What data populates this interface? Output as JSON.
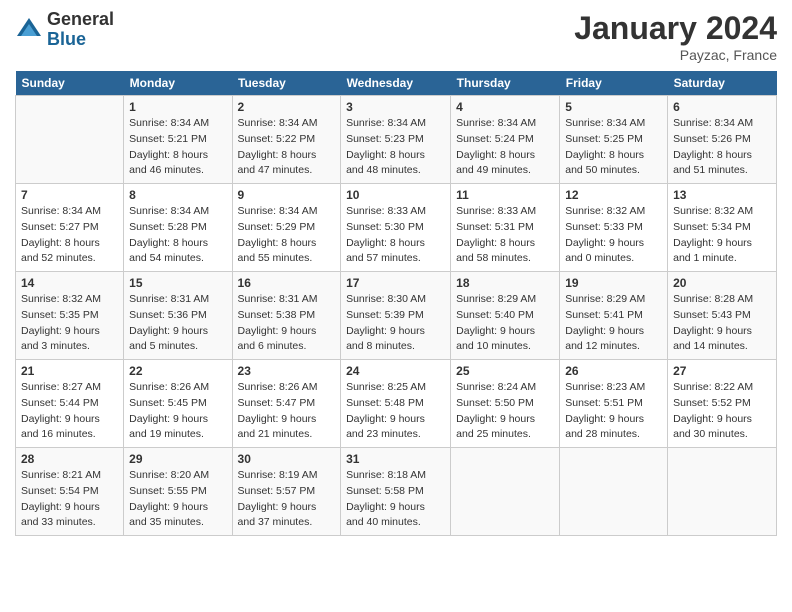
{
  "logo": {
    "general": "General",
    "blue": "Blue"
  },
  "header": {
    "month": "January 2024",
    "location": "Payzac, France"
  },
  "weekdays": [
    "Sunday",
    "Monday",
    "Tuesday",
    "Wednesday",
    "Thursday",
    "Friday",
    "Saturday"
  ],
  "weeks": [
    [
      {
        "day": "",
        "sunrise": "",
        "sunset": "",
        "daylight": ""
      },
      {
        "day": "1",
        "sunrise": "Sunrise: 8:34 AM",
        "sunset": "Sunset: 5:21 PM",
        "daylight": "Daylight: 8 hours and 46 minutes."
      },
      {
        "day": "2",
        "sunrise": "Sunrise: 8:34 AM",
        "sunset": "Sunset: 5:22 PM",
        "daylight": "Daylight: 8 hours and 47 minutes."
      },
      {
        "day": "3",
        "sunrise": "Sunrise: 8:34 AM",
        "sunset": "Sunset: 5:23 PM",
        "daylight": "Daylight: 8 hours and 48 minutes."
      },
      {
        "day": "4",
        "sunrise": "Sunrise: 8:34 AM",
        "sunset": "Sunset: 5:24 PM",
        "daylight": "Daylight: 8 hours and 49 minutes."
      },
      {
        "day": "5",
        "sunrise": "Sunrise: 8:34 AM",
        "sunset": "Sunset: 5:25 PM",
        "daylight": "Daylight: 8 hours and 50 minutes."
      },
      {
        "day": "6",
        "sunrise": "Sunrise: 8:34 AM",
        "sunset": "Sunset: 5:26 PM",
        "daylight": "Daylight: 8 hours and 51 minutes."
      }
    ],
    [
      {
        "day": "7",
        "sunrise": "Sunrise: 8:34 AM",
        "sunset": "Sunset: 5:27 PM",
        "daylight": "Daylight: 8 hours and 52 minutes."
      },
      {
        "day": "8",
        "sunrise": "Sunrise: 8:34 AM",
        "sunset": "Sunset: 5:28 PM",
        "daylight": "Daylight: 8 hours and 54 minutes."
      },
      {
        "day": "9",
        "sunrise": "Sunrise: 8:34 AM",
        "sunset": "Sunset: 5:29 PM",
        "daylight": "Daylight: 8 hours and 55 minutes."
      },
      {
        "day": "10",
        "sunrise": "Sunrise: 8:33 AM",
        "sunset": "Sunset: 5:30 PM",
        "daylight": "Daylight: 8 hours and 57 minutes."
      },
      {
        "day": "11",
        "sunrise": "Sunrise: 8:33 AM",
        "sunset": "Sunset: 5:31 PM",
        "daylight": "Daylight: 8 hours and 58 minutes."
      },
      {
        "day": "12",
        "sunrise": "Sunrise: 8:32 AM",
        "sunset": "Sunset: 5:33 PM",
        "daylight": "Daylight: 9 hours and 0 minutes."
      },
      {
        "day": "13",
        "sunrise": "Sunrise: 8:32 AM",
        "sunset": "Sunset: 5:34 PM",
        "daylight": "Daylight: 9 hours and 1 minute."
      }
    ],
    [
      {
        "day": "14",
        "sunrise": "Sunrise: 8:32 AM",
        "sunset": "Sunset: 5:35 PM",
        "daylight": "Daylight: 9 hours and 3 minutes."
      },
      {
        "day": "15",
        "sunrise": "Sunrise: 8:31 AM",
        "sunset": "Sunset: 5:36 PM",
        "daylight": "Daylight: 9 hours and 5 minutes."
      },
      {
        "day": "16",
        "sunrise": "Sunrise: 8:31 AM",
        "sunset": "Sunset: 5:38 PM",
        "daylight": "Daylight: 9 hours and 6 minutes."
      },
      {
        "day": "17",
        "sunrise": "Sunrise: 8:30 AM",
        "sunset": "Sunset: 5:39 PM",
        "daylight": "Daylight: 9 hours and 8 minutes."
      },
      {
        "day": "18",
        "sunrise": "Sunrise: 8:29 AM",
        "sunset": "Sunset: 5:40 PM",
        "daylight": "Daylight: 9 hours and 10 minutes."
      },
      {
        "day": "19",
        "sunrise": "Sunrise: 8:29 AM",
        "sunset": "Sunset: 5:41 PM",
        "daylight": "Daylight: 9 hours and 12 minutes."
      },
      {
        "day": "20",
        "sunrise": "Sunrise: 8:28 AM",
        "sunset": "Sunset: 5:43 PM",
        "daylight": "Daylight: 9 hours and 14 minutes."
      }
    ],
    [
      {
        "day": "21",
        "sunrise": "Sunrise: 8:27 AM",
        "sunset": "Sunset: 5:44 PM",
        "daylight": "Daylight: 9 hours and 16 minutes."
      },
      {
        "day": "22",
        "sunrise": "Sunrise: 8:26 AM",
        "sunset": "Sunset: 5:45 PM",
        "daylight": "Daylight: 9 hours and 19 minutes."
      },
      {
        "day": "23",
        "sunrise": "Sunrise: 8:26 AM",
        "sunset": "Sunset: 5:47 PM",
        "daylight": "Daylight: 9 hours and 21 minutes."
      },
      {
        "day": "24",
        "sunrise": "Sunrise: 8:25 AM",
        "sunset": "Sunset: 5:48 PM",
        "daylight": "Daylight: 9 hours and 23 minutes."
      },
      {
        "day": "25",
        "sunrise": "Sunrise: 8:24 AM",
        "sunset": "Sunset: 5:50 PM",
        "daylight": "Daylight: 9 hours and 25 minutes."
      },
      {
        "day": "26",
        "sunrise": "Sunrise: 8:23 AM",
        "sunset": "Sunset: 5:51 PM",
        "daylight": "Daylight: 9 hours and 28 minutes."
      },
      {
        "day": "27",
        "sunrise": "Sunrise: 8:22 AM",
        "sunset": "Sunset: 5:52 PM",
        "daylight": "Daylight: 9 hours and 30 minutes."
      }
    ],
    [
      {
        "day": "28",
        "sunrise": "Sunrise: 8:21 AM",
        "sunset": "Sunset: 5:54 PM",
        "daylight": "Daylight: 9 hours and 33 minutes."
      },
      {
        "day": "29",
        "sunrise": "Sunrise: 8:20 AM",
        "sunset": "Sunset: 5:55 PM",
        "daylight": "Daylight: 9 hours and 35 minutes."
      },
      {
        "day": "30",
        "sunrise": "Sunrise: 8:19 AM",
        "sunset": "Sunset: 5:57 PM",
        "daylight": "Daylight: 9 hours and 37 minutes."
      },
      {
        "day": "31",
        "sunrise": "Sunrise: 8:18 AM",
        "sunset": "Sunset: 5:58 PM",
        "daylight": "Daylight: 9 hours and 40 minutes."
      },
      {
        "day": "",
        "sunrise": "",
        "sunset": "",
        "daylight": ""
      },
      {
        "day": "",
        "sunrise": "",
        "sunset": "",
        "daylight": ""
      },
      {
        "day": "",
        "sunrise": "",
        "sunset": "",
        "daylight": ""
      }
    ]
  ]
}
